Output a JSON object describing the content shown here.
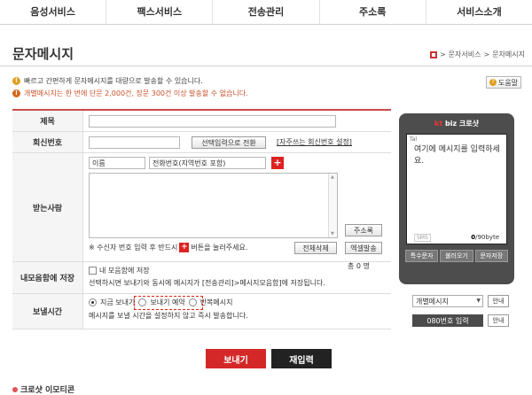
{
  "nav": [
    "음성서비스",
    "팩스서비스",
    "전송관리",
    "주소록",
    "서비스소개"
  ],
  "page_title": "문자메시지",
  "breadcrumb": [
    "문자서비스",
    "문자메시지"
  ],
  "breadcrumb_sep": ">",
  "info": {
    "line1": "빠르고 간편하게 문자메시지를 대량으로 발송할 수 있습니다.",
    "line2": "개별메시지는 한 번에 단문 2,000건, 장문 300건 이상 발송할 수 없습니다."
  },
  "help_label": "도움말",
  "form": {
    "title_label": "제목",
    "reply_label": "회신번호",
    "reply_button": "선택입력으로 전환",
    "reply_link": "[자주쓰는 회신번호 설정]",
    "recv_label": "받는사람",
    "name_placeholder": "이름",
    "phone_placeholder": "전화번호(지역번호 포함)",
    "address_button": "주소록",
    "excel_button": "엑셀발송",
    "recv_count": "총 0 명",
    "recv_note_pre": "※ 수신자 번호 입력 후 반드시",
    "recv_note_post": "버튼을 눌러주세요.",
    "delete_all_button": "전체삭제",
    "save_label": "내모음함에 저장",
    "save_check": "내 모음함에 저장",
    "save_desc": "선택하시면 보내기와 동시에 메시지가 [전송관리]>메시지모음함]에 저장됩니다.",
    "time_label": "보낼시간",
    "time_options": [
      "지금 보내기",
      "보내기 예약",
      "반복메시지"
    ],
    "time_desc": "메시지를 보낼 시간을 설정하지 않고 즉시 발송합니다."
  },
  "phone": {
    "brand_kt": "kt",
    "brand_rest": "biz 크로샷",
    "signal": "Tal",
    "message": "여기에 메시지를 입력하세요.",
    "sms": "SMS",
    "bytes_used": "0",
    "bytes_total": "/90byte",
    "buttons": [
      "특수문자",
      "불러오기",
      "문자저장"
    ]
  },
  "select_value": "개별메시지",
  "send_ct_label": "080번호 입력",
  "guide_label": "안내",
  "send_button": "보내기",
  "reset_button": "재입력",
  "emoticon_title": "크로샷 이모티콘"
}
